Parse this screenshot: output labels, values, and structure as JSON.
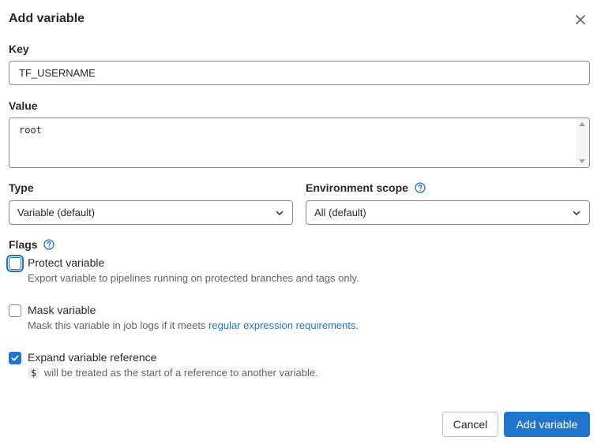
{
  "modal": {
    "title": "Add variable",
    "close_icon": "close-icon"
  },
  "key": {
    "label": "Key",
    "value": "TF_USERNAME"
  },
  "value_field": {
    "label": "Value",
    "value": "root"
  },
  "type": {
    "label": "Type",
    "selected": "Variable (default)"
  },
  "environment_scope": {
    "label": "Environment scope",
    "selected": "All (default)"
  },
  "flags": {
    "label": "Flags",
    "protect": {
      "label": "Protect variable",
      "help": "Export variable to pipelines running on protected branches and tags only.",
      "checked": false
    },
    "mask": {
      "label": "Mask variable",
      "help_prefix": "Mask this variable in job logs if it meets ",
      "help_link": "regular expression requirements",
      "help_suffix": ".",
      "checked": false
    },
    "expand": {
      "label": "Expand variable reference",
      "code": "$",
      "help": " will be treated as the start of a reference to another variable.",
      "checked": true
    }
  },
  "footer": {
    "cancel_label": "Cancel",
    "submit_label": "Add variable"
  },
  "colors": {
    "accent": "#1f75cb",
    "text": "#28272d",
    "muted": "#626168",
    "border": "#89888d"
  }
}
